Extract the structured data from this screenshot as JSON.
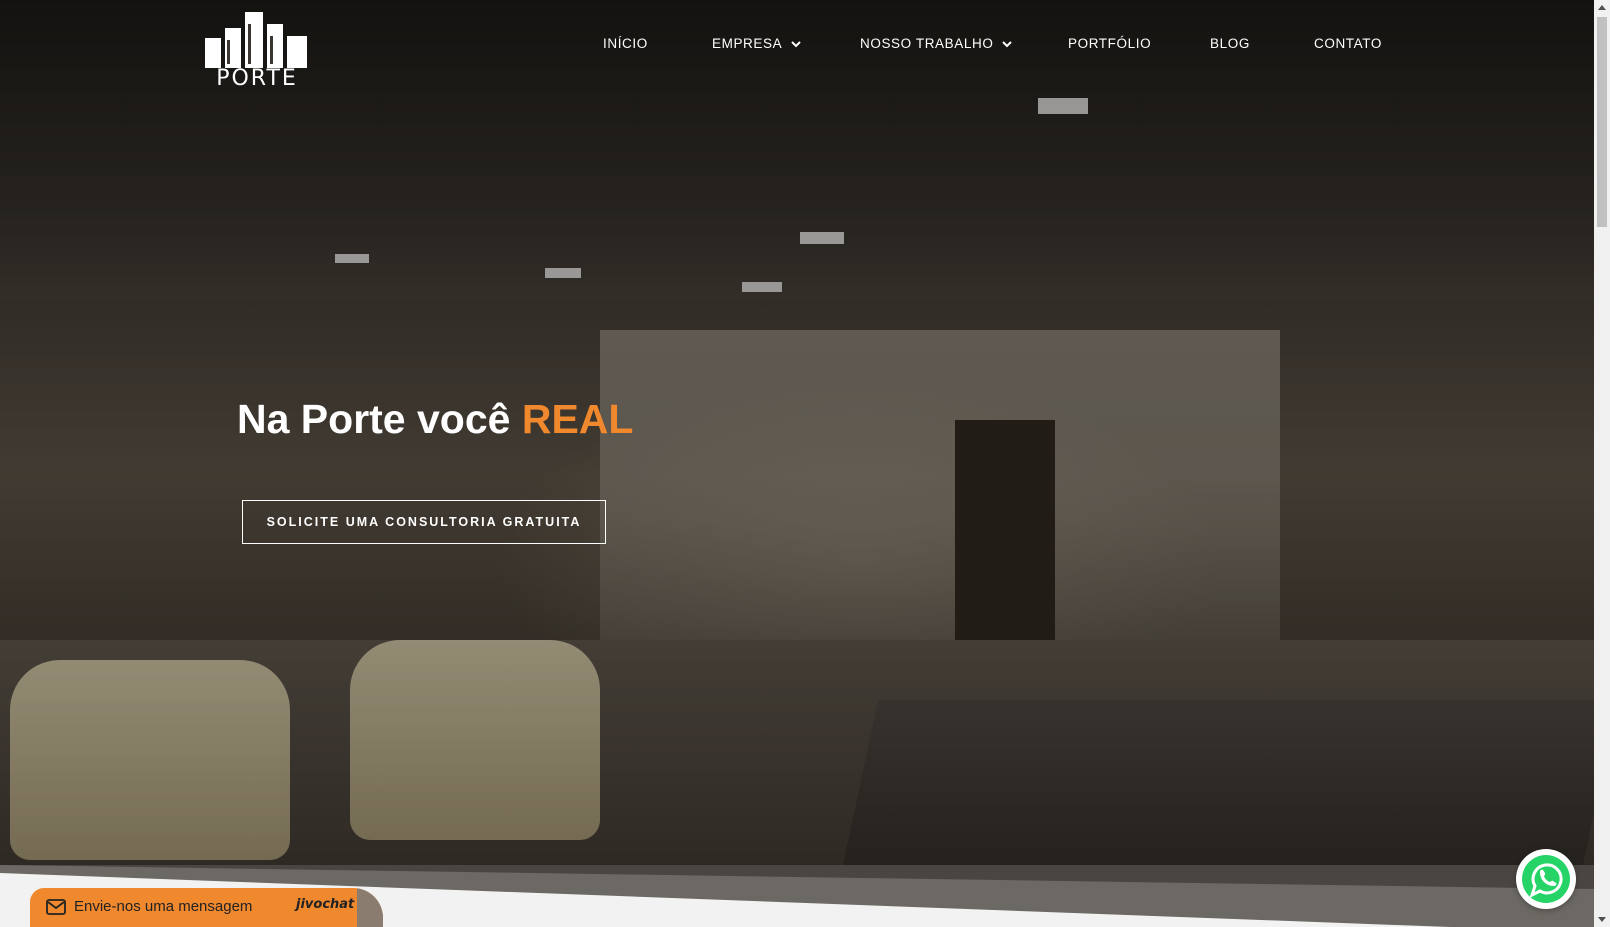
{
  "header": {
    "logo_text": "PORTE"
  },
  "nav": {
    "items": [
      {
        "label": "INÍCIO",
        "has_dropdown": false
      },
      {
        "label": "EMPRESA",
        "has_dropdown": true
      },
      {
        "label": "NOSSO TRABALHO",
        "has_dropdown": true
      },
      {
        "label": "PORTFÓLIO",
        "has_dropdown": false
      },
      {
        "label": "BLOG",
        "has_dropdown": false
      },
      {
        "label": "CONTATO",
        "has_dropdown": false
      }
    ]
  },
  "hero": {
    "headline_prefix": "Na Porte você ",
    "headline_accent": "REAL",
    "cta_label": "SOLICITE UMA CONSULTORIA GRATUITA"
  },
  "chat_widget": {
    "label": "Envie-nos uma mensagem",
    "brand": "jivochat"
  },
  "icons": {
    "chat": "mail-icon",
    "floating": "whatsapp-icon",
    "dropdown": "chevron-down-icon"
  },
  "colors": {
    "accent": "#f0882e",
    "text_on_hero": "#ffffff",
    "whatsapp_green": "#25d366"
  }
}
